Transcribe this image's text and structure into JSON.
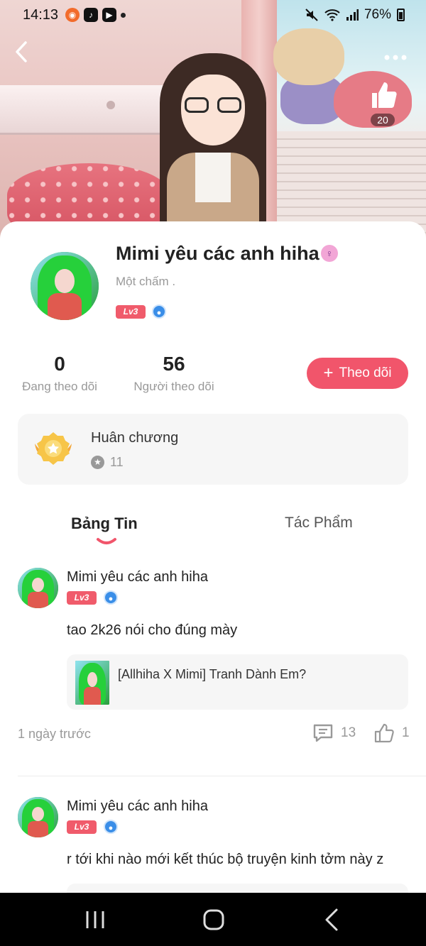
{
  "status_bar": {
    "time": "14:13",
    "battery": "76%",
    "icons": [
      "app-notification-icon",
      "tiktok-icon",
      "youtube-icon",
      "dot-icon",
      "mute-icon",
      "wifi-icon",
      "signal-icon",
      "battery-icon"
    ]
  },
  "header": {
    "like_count": "20"
  },
  "profile": {
    "name": "Mimi yêu các anh hiha",
    "bio": "Một chấm .",
    "level": "Lv3",
    "gender_symbol": "♀"
  },
  "stats": {
    "following_value": "0",
    "following_label": "Đang theo dõi",
    "followers_value": "56",
    "followers_label": "Người theo dõi"
  },
  "follow_button": {
    "plus": "+",
    "label": "Theo dõi"
  },
  "medals": {
    "title": "Huân chương",
    "count": "11"
  },
  "tabs": {
    "feed": "Bảng Tin",
    "works": "Tác Phẩm"
  },
  "posts": [
    {
      "author": "Mimi yêu các anh hiha",
      "level": "Lv3",
      "text": "tao 2k26 nói cho đúng mày",
      "link_title": "[Allhiha X Mimi] Tranh Dành Em?",
      "time": "1 ngày trước",
      "comments": "13",
      "likes": "1"
    },
    {
      "author": "Mimi yêu các anh hiha",
      "level": "Lv3",
      "text": "r tới khi nào mới kết thúc bộ truyện kinh tởm này z"
    }
  ],
  "colors": {
    "accent": "#f1556b",
    "level_badge": "#f05b6b",
    "vip_badge": "#3a8ee8",
    "muted_text": "#999999"
  }
}
